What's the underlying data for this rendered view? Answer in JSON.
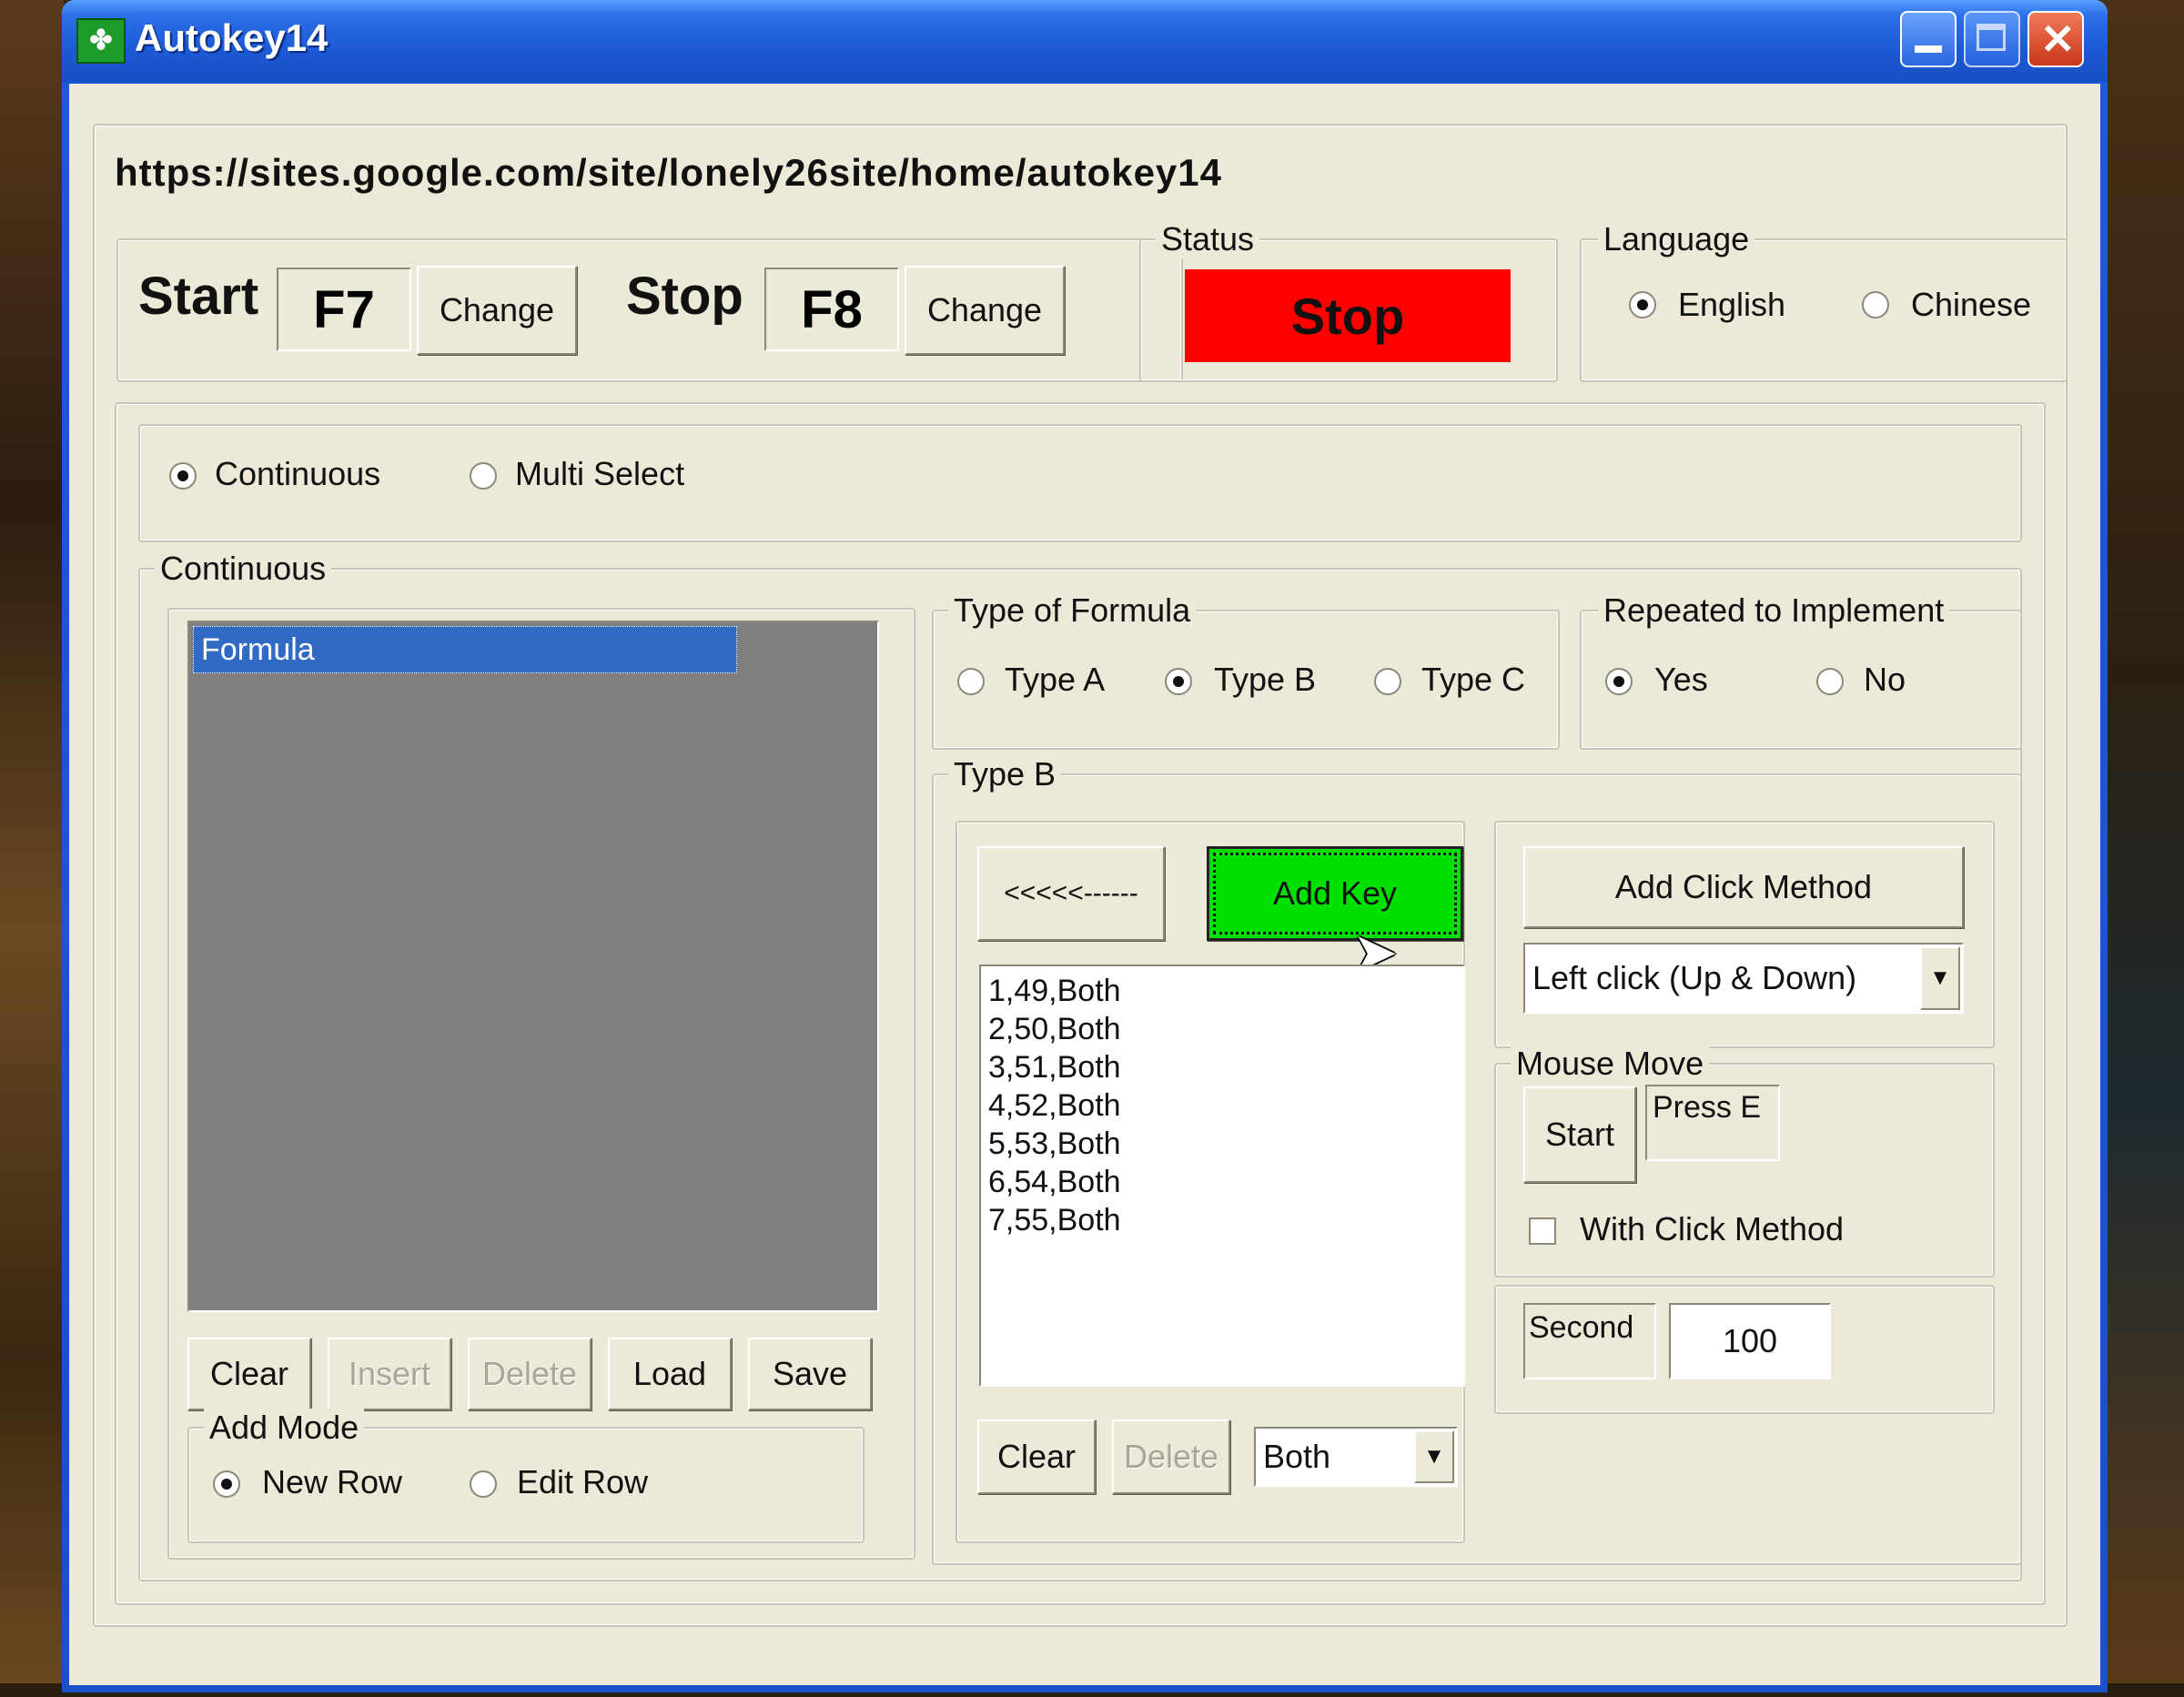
{
  "window": {
    "title": "Autokey14",
    "url_text": "https://sites.google.com/site/lonely26site/home/autokey14"
  },
  "hotkeys": {
    "start_label": "Start",
    "start_key": "F7",
    "start_change": "Change",
    "stop_label": "Stop",
    "stop_key": "F8",
    "stop_change": "Change"
  },
  "status": {
    "group_label": "Status",
    "value": "Stop",
    "color": "#ff0000"
  },
  "language": {
    "group_label": "Language",
    "options": [
      "English",
      "Chinese"
    ],
    "selected": "English"
  },
  "mode": {
    "options": [
      "Continuous",
      "Multi Select"
    ],
    "selected": "Continuous"
  },
  "continuous": {
    "group_label": "Continuous",
    "formula_list": {
      "items": [
        "Formula"
      ],
      "selected_index": 0
    },
    "buttons": {
      "clear": "Clear",
      "insert": "Insert",
      "delete": "Delete",
      "load": "Load",
      "save": "Save"
    },
    "add_mode": {
      "group_label": "Add Mode",
      "options": [
        "New Row",
        "Edit Row"
      ],
      "selected": "New Row"
    }
  },
  "type_of_formula": {
    "group_label": "Type of Formula",
    "options": [
      "Type A",
      "Type B",
      "Type C"
    ],
    "selected": "Type B"
  },
  "repeated": {
    "group_label": "Repeated to Implement",
    "options": [
      "Yes",
      "No"
    ],
    "selected": "Yes"
  },
  "type_b": {
    "group_label": "Type B",
    "back_button": "<<<<<------",
    "add_key_button": "Add Key",
    "add_key_color": "#00e000",
    "key_list": [
      "1,49,Both",
      "2,50,Both",
      "3,51,Both",
      "4,52,Both",
      "5,53,Both",
      "6,54,Both",
      "7,55,Both"
    ],
    "clear_button": "Clear",
    "delete_button": "Delete",
    "both_select": "Both"
  },
  "click_method": {
    "add_button": "Add Click Method",
    "select_value": "Left click (Up & Down)"
  },
  "mouse_move": {
    "group_label": "Mouse Move",
    "start_button": "Start",
    "press_label": "Press E",
    "checkbox_label": "With Click Method",
    "checked": false
  },
  "second": {
    "label": "Second",
    "value": "100"
  }
}
